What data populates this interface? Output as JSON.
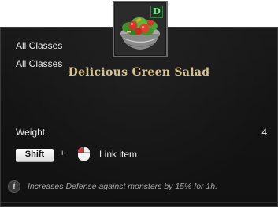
{
  "item": {
    "icon": "green-salad-bowl-icon",
    "grade_badge": "D",
    "title": "Delicious Green Salad",
    "class_lines": [
      "All Classes",
      "All Classes"
    ],
    "weight_label": "Weight",
    "weight_value": "4",
    "link_hint": {
      "key_label": "Shift",
      "plus": "+",
      "mouse_icon": "mouse-click-icon",
      "action_label": "Link item"
    },
    "description_icon": "info-icon",
    "description_icon_glyph": "i",
    "description": "Increases Defense against monsters by 15% for 1h."
  },
  "colors": {
    "title": "#d9c28c",
    "badge_text": "#7ee08f",
    "background": "#151515"
  }
}
